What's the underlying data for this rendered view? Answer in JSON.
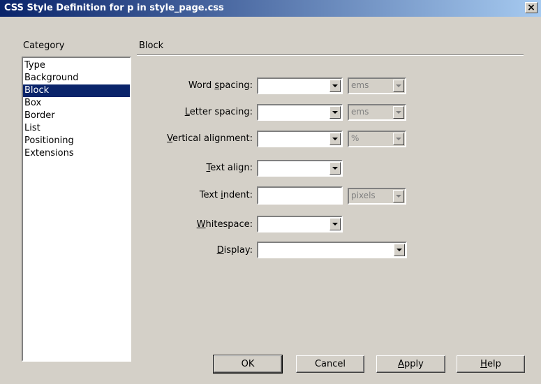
{
  "window": {
    "title": "CSS Style Definition for p in style_page.css",
    "close_glyph": "×"
  },
  "category": {
    "label": "Category",
    "items": [
      "Type",
      "Background",
      "Block",
      "Box",
      "Border",
      "List",
      "Positioning",
      "Extensions"
    ],
    "selected": "Block"
  },
  "panel": {
    "title": "Block"
  },
  "fields": {
    "word_spacing": {
      "pre": "Word ",
      "key": "s",
      "post": "pacing:",
      "value": "",
      "unit": "ems"
    },
    "letter_spacing": {
      "pre": "",
      "key": "L",
      "post": "etter spacing:",
      "value": "",
      "unit": "ems"
    },
    "vertical_alignment": {
      "pre": "",
      "key": "V",
      "post": "ertical alignment:",
      "value": "",
      "unit": "%"
    },
    "text_align": {
      "pre": "",
      "key": "T",
      "post": "ext align:",
      "value": ""
    },
    "text_indent": {
      "pre": "Text ",
      "key": "i",
      "post": "ndent:",
      "value": "",
      "unit": "pixels"
    },
    "whitespace": {
      "pre": "",
      "key": "W",
      "post": "hitespace:",
      "value": ""
    },
    "display": {
      "pre": "",
      "key": "D",
      "post": "isplay:",
      "value": ""
    }
  },
  "buttons": {
    "ok": {
      "pre": "OK",
      "key": "",
      "post": ""
    },
    "cancel": {
      "pre": "Cancel",
      "key": "",
      "post": ""
    },
    "apply": {
      "pre": "",
      "key": "A",
      "post": "pply"
    },
    "help": {
      "pre": "",
      "key": "H",
      "post": "elp"
    }
  },
  "colors": {
    "face": "#d4d0c8",
    "title_start": "#0a246a",
    "title_end": "#a6caf0",
    "selection": "#0a246a"
  }
}
